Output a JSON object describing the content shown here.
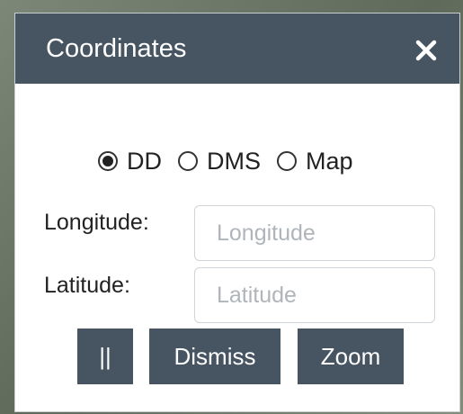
{
  "dialog": {
    "title": "Coordinates",
    "close_icon": "close-icon"
  },
  "format": {
    "options": [
      {
        "label": "DD",
        "selected": true
      },
      {
        "label": "DMS",
        "selected": false
      },
      {
        "label": "Map",
        "selected": false
      }
    ]
  },
  "fields": {
    "longitude": {
      "label": "Longitude:",
      "value": "",
      "placeholder": "Longitude"
    },
    "latitude": {
      "label": "Latitude:",
      "value": "",
      "placeholder": "Latitude"
    }
  },
  "buttons": {
    "pause_label": "||",
    "dismiss_label": "Dismiss",
    "zoom_label": "Zoom"
  },
  "colors": {
    "header": "#475563",
    "button": "#475563",
    "text": "#222222",
    "placeholder": "#b0b5ba"
  }
}
